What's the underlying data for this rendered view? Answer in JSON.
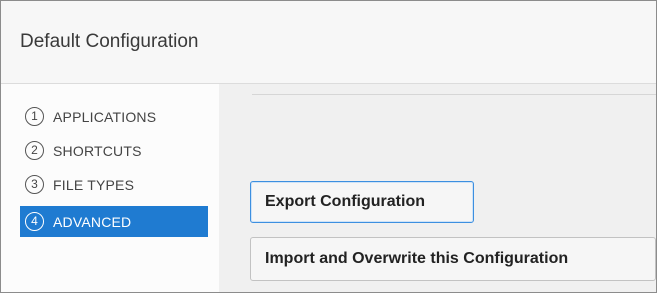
{
  "window": {
    "title": "Default Configuration"
  },
  "sidebar": {
    "items": [
      {
        "number": "1",
        "label": "APPLICATIONS",
        "active": false
      },
      {
        "number": "2",
        "label": "SHORTCUTS",
        "active": false
      },
      {
        "number": "3",
        "label": "FILE TYPES",
        "active": false
      },
      {
        "number": "4",
        "label": "ADVANCED",
        "active": true
      }
    ]
  },
  "content": {
    "export_button_label": "Export Configuration",
    "import_button_label": "Import and Overwrite this Configuration"
  },
  "colors": {
    "accent": "#1f7bd1",
    "focus_border": "#3c8fe0",
    "content_background": "#f0f0f0"
  }
}
